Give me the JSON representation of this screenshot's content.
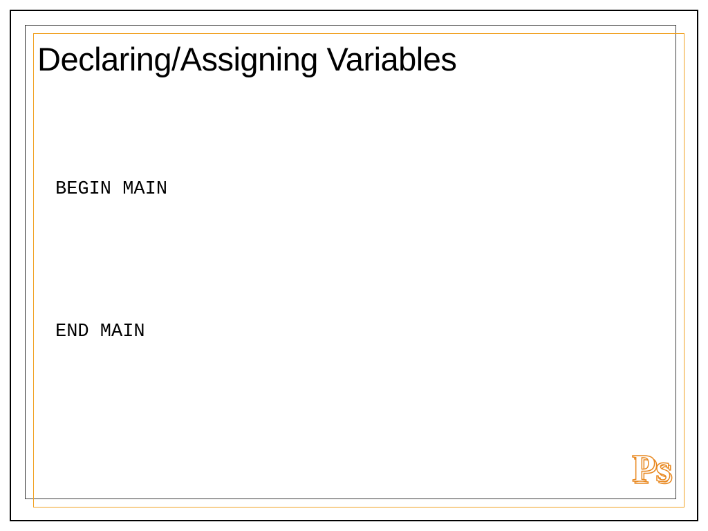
{
  "slide": {
    "title": "Declaring/Assigning Variables",
    "code": {
      "line1": "BEGIN MAIN",
      "line2": "END MAIN"
    },
    "logo": "Ps"
  },
  "colors": {
    "border_outer": "#000000",
    "border_dark": "#3a3a3a",
    "border_orange": "#f0a020",
    "logo_stroke": "#e88820"
  }
}
